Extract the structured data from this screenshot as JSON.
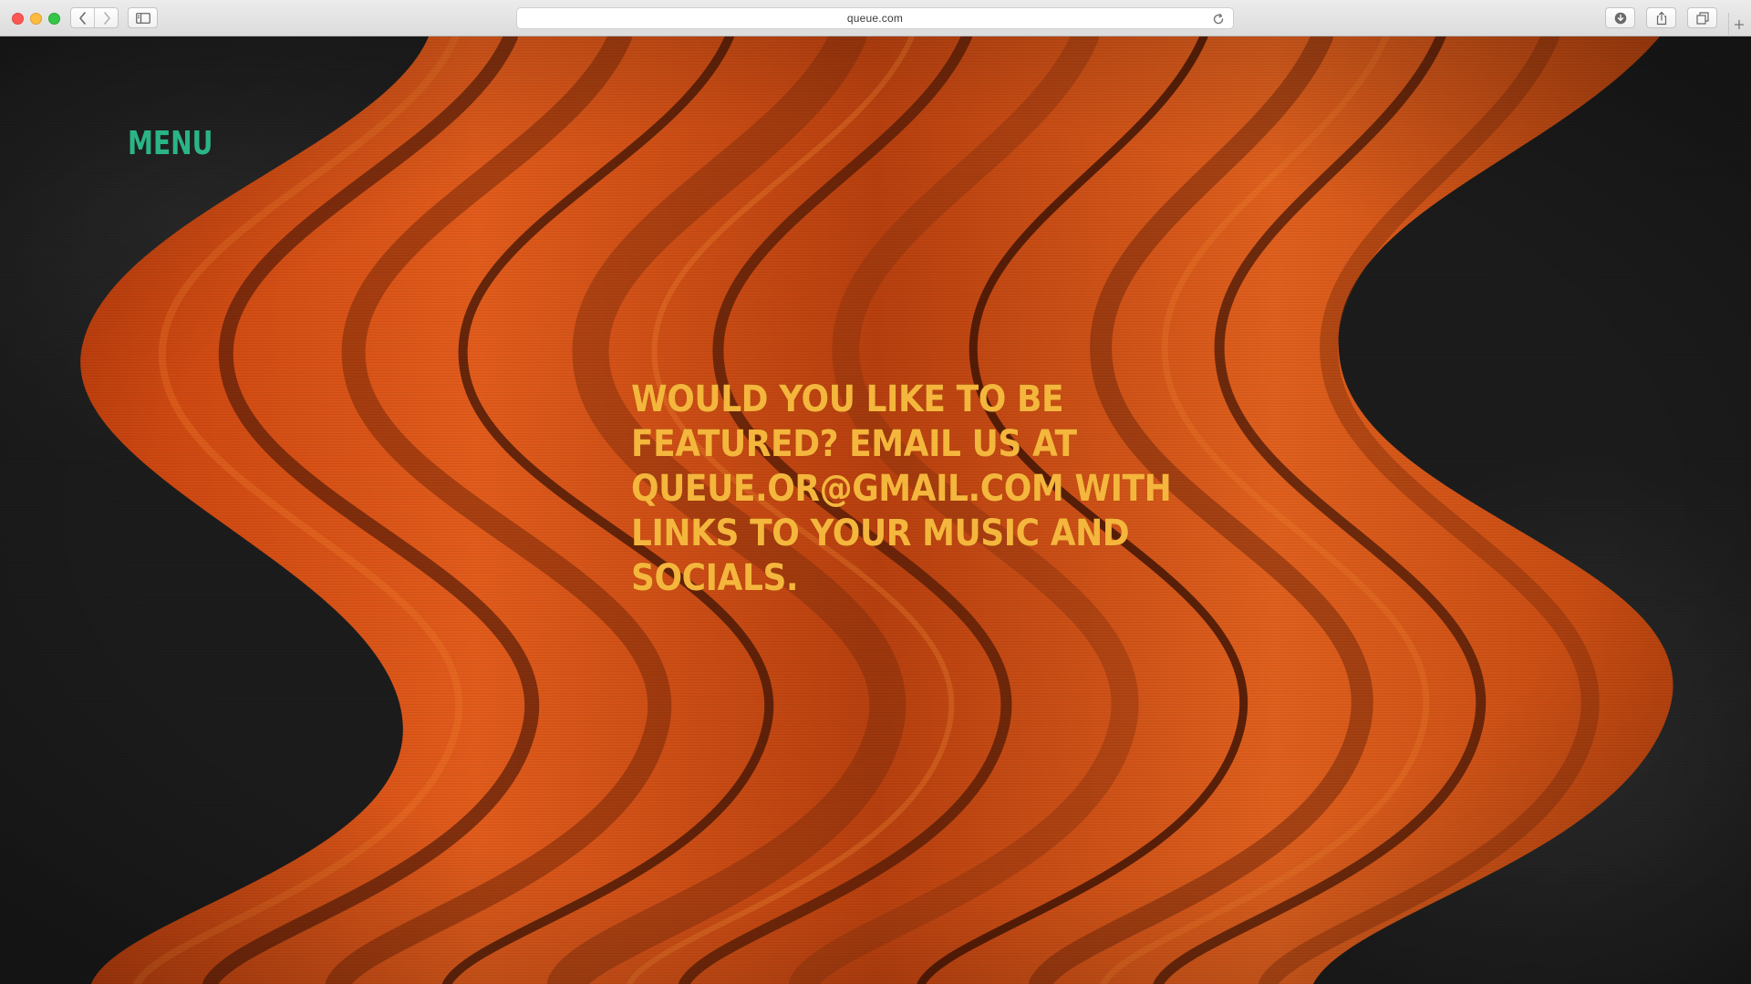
{
  "browser": {
    "url": "queue.com",
    "icons": {
      "close": "close-dot",
      "minimize": "minimize-dot",
      "maximize": "maximize-dot",
      "back": "chevron-left-icon",
      "forward": "chevron-right-icon",
      "sidebar": "sidebar-icon",
      "reload": "reload-icon",
      "download": "download-icon",
      "share": "share-icon",
      "tabs": "tabs-icon",
      "new_tab": "plus-icon"
    }
  },
  "page": {
    "menu_label": "MENU",
    "feature_message": "WOULD YOU LIKE TO BE FEATURED? EMAIL US AT QUEUE.OR@GMAIL.COM WITH LINKS TO YOUR MUSIC AND SOCIALS.",
    "colors": {
      "menu": "#2ab585",
      "message": "#f4b63c",
      "wave_orange": "#e2571a",
      "background": "#1c1c1c"
    }
  }
}
